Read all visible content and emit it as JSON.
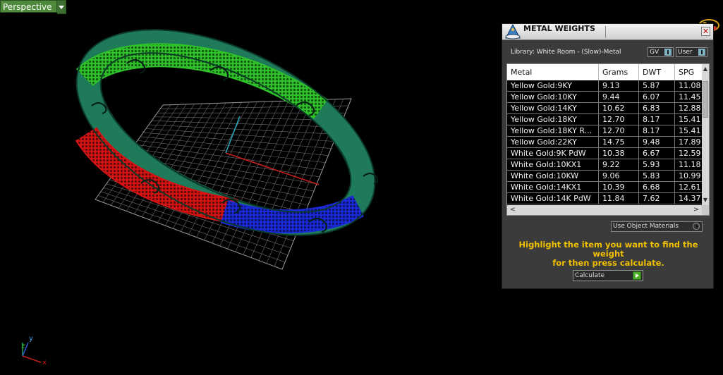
{
  "viewport": {
    "label": "Perspective"
  },
  "axis_labels": {
    "x": "x",
    "y": "y",
    "z": "z"
  },
  "panel": {
    "title": "METAL WEIGHTS",
    "library_label": "Library: White Room - (Slow)-Metal",
    "gv_button": "GV",
    "user_button": "User",
    "columns": [
      "Metal",
      "Grams",
      "DWT",
      "SPG"
    ],
    "rows": [
      [
        "Yellow Gold:9KY",
        "9.13",
        "5.87",
        "11.08"
      ],
      [
        "Yellow Gold:10KY",
        "9.44",
        "6.07",
        "11.45"
      ],
      [
        "Yellow Gold:14KY",
        "10.62",
        "6.83",
        "12.88"
      ],
      [
        "Yellow Gold:18KY",
        "12.70",
        "8.17",
        "15.41"
      ],
      [
        "Yellow Gold:18KY R...",
        "12.70",
        "8.17",
        "15.41"
      ],
      [
        "Yellow Gold:22KY",
        "14.75",
        "9.48",
        "17.89"
      ],
      [
        "White Gold:9K PdW",
        "10.38",
        "6.67",
        "12.59"
      ],
      [
        "White Gold:10KX1",
        "9.22",
        "5.93",
        "11.18"
      ],
      [
        "White Gold:10KW",
        "9.06",
        "5.83",
        "10.99"
      ],
      [
        "White Gold:14KX1",
        "10.39",
        "6.68",
        "12.61"
      ],
      [
        "White Gold:14K PdW",
        "11.84",
        "7.62",
        "14.37"
      ]
    ],
    "use_object_materials": "Use Object Materials",
    "message_line1": "Highlight the item you want to find the weight",
    "message_line2": "for then press calculate.",
    "calculate_button": "Calculate"
  },
  "colors": {
    "green": "#2fc22a",
    "teal": "#1f7a5a",
    "red": "#d41414",
    "blue": "#1a2ad8",
    "message": "#f0c000"
  }
}
